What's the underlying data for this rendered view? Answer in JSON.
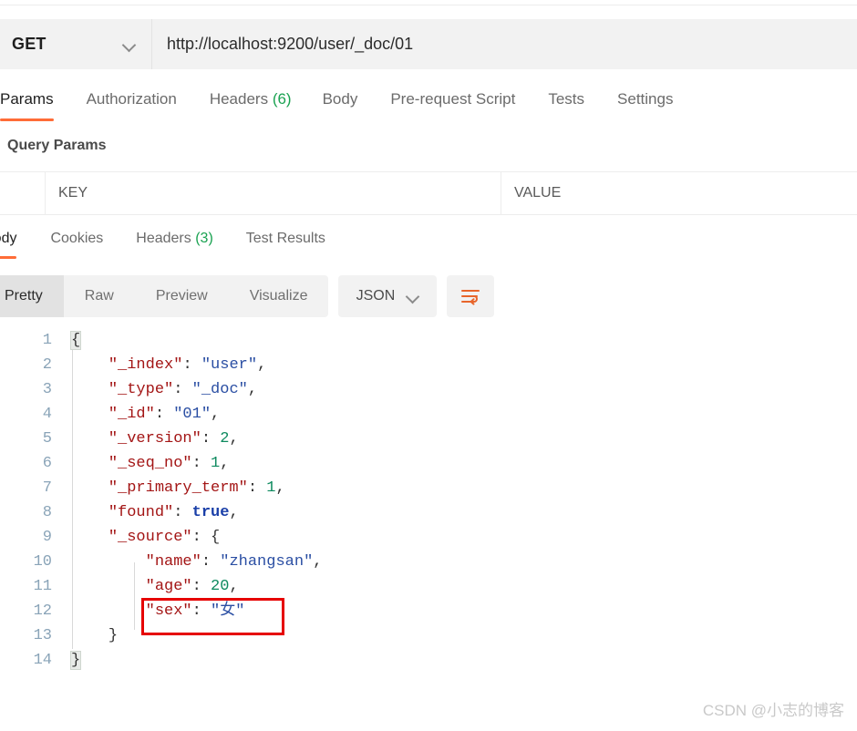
{
  "request": {
    "method": "GET",
    "method_dropdown_icon": "chevron-down-icon",
    "url": "http://localhost:9200/user/_doc/01",
    "url_placeholder": "Enter request URL",
    "tabs": [
      {
        "label": "Params",
        "count": "",
        "active": true
      },
      {
        "label": "Authorization",
        "count": "",
        "active": false
      },
      {
        "label": "Headers",
        "count": "(6)",
        "active": false
      },
      {
        "label": "Body",
        "count": "",
        "active": false
      },
      {
        "label": "Pre-request Script",
        "count": "",
        "active": false
      },
      {
        "label": "Tests",
        "count": "",
        "active": false
      },
      {
        "label": "Settings",
        "count": "",
        "active": false
      }
    ]
  },
  "query_params": {
    "title": "Query Params",
    "columns": [
      "KEY",
      "VALUE"
    ]
  },
  "response": {
    "tabs": [
      {
        "label": "Body",
        "count": "",
        "active": true
      },
      {
        "label": "Cookies",
        "count": "",
        "active": false
      },
      {
        "label": "Headers",
        "count": "(3)",
        "active": false
      },
      {
        "label": "Test Results",
        "count": "",
        "active": false
      }
    ],
    "view_modes": [
      "Pretty",
      "Raw",
      "Preview",
      "Visualize"
    ],
    "active_view_mode": "Pretty",
    "format": "JSON",
    "format_dropdown_icon": "chevron-down-icon",
    "wrap_button_icon": "text-wrap-icon"
  },
  "code": {
    "lines": [
      {
        "no": "1",
        "segments": [
          {
            "t": "{",
            "c": "p br-hl"
          }
        ]
      },
      {
        "no": "2",
        "segments": [
          {
            "t": "    ",
            "c": "p"
          },
          {
            "t": "\"_index\"",
            "c": "k"
          },
          {
            "t": ": ",
            "c": "p"
          },
          {
            "t": "\"user\"",
            "c": "s"
          },
          {
            "t": ",",
            "c": "p"
          }
        ]
      },
      {
        "no": "3",
        "segments": [
          {
            "t": "    ",
            "c": "p"
          },
          {
            "t": "\"_type\"",
            "c": "k"
          },
          {
            "t": ": ",
            "c": "p"
          },
          {
            "t": "\"_doc\"",
            "c": "s"
          },
          {
            "t": ",",
            "c": "p"
          }
        ]
      },
      {
        "no": "4",
        "segments": [
          {
            "t": "    ",
            "c": "p"
          },
          {
            "t": "\"_id\"",
            "c": "k"
          },
          {
            "t": ": ",
            "c": "p"
          },
          {
            "t": "\"01\"",
            "c": "s"
          },
          {
            "t": ",",
            "c": "p"
          }
        ]
      },
      {
        "no": "5",
        "segments": [
          {
            "t": "    ",
            "c": "p"
          },
          {
            "t": "\"_version\"",
            "c": "k"
          },
          {
            "t": ": ",
            "c": "p"
          },
          {
            "t": "2",
            "c": "n"
          },
          {
            "t": ",",
            "c": "p"
          }
        ]
      },
      {
        "no": "6",
        "segments": [
          {
            "t": "    ",
            "c": "p"
          },
          {
            "t": "\"_seq_no\"",
            "c": "k"
          },
          {
            "t": ": ",
            "c": "p"
          },
          {
            "t": "1",
            "c": "n"
          },
          {
            "t": ",",
            "c": "p"
          }
        ]
      },
      {
        "no": "7",
        "segments": [
          {
            "t": "    ",
            "c": "p"
          },
          {
            "t": "\"_primary_term\"",
            "c": "k"
          },
          {
            "t": ": ",
            "c": "p"
          },
          {
            "t": "1",
            "c": "n"
          },
          {
            "t": ",",
            "c": "p"
          }
        ]
      },
      {
        "no": "8",
        "segments": [
          {
            "t": "    ",
            "c": "p"
          },
          {
            "t": "\"found\"",
            "c": "k"
          },
          {
            "t": ": ",
            "c": "p"
          },
          {
            "t": "true",
            "c": "b"
          },
          {
            "t": ",",
            "c": "p"
          }
        ]
      },
      {
        "no": "9",
        "segments": [
          {
            "t": "    ",
            "c": "p"
          },
          {
            "t": "\"_source\"",
            "c": "k"
          },
          {
            "t": ": ",
            "c": "p"
          },
          {
            "t": "{",
            "c": "p"
          }
        ]
      },
      {
        "no": "10",
        "segments": [
          {
            "t": "        ",
            "c": "p"
          },
          {
            "t": "\"name\"",
            "c": "k"
          },
          {
            "t": ": ",
            "c": "p"
          },
          {
            "t": "\"zhangsan\"",
            "c": "s"
          },
          {
            "t": ",",
            "c": "p"
          }
        ]
      },
      {
        "no": "11",
        "segments": [
          {
            "t": "        ",
            "c": "p"
          },
          {
            "t": "\"age\"",
            "c": "k"
          },
          {
            "t": ": ",
            "c": "p"
          },
          {
            "t": "20",
            "c": "n"
          },
          {
            "t": ",",
            "c": "p"
          }
        ]
      },
      {
        "no": "12",
        "segments": [
          {
            "t": "        ",
            "c": "p"
          },
          {
            "t": "\"sex\"",
            "c": "k"
          },
          {
            "t": ": ",
            "c": "p"
          },
          {
            "t": "\"女\"",
            "c": "s"
          }
        ]
      },
      {
        "no": "13",
        "segments": [
          {
            "t": "    ",
            "c": "p"
          },
          {
            "t": "}",
            "c": "p"
          }
        ]
      },
      {
        "no": "14",
        "segments": [
          {
            "t": "}",
            "c": "p br-hl"
          }
        ]
      }
    ],
    "highlight_note": "red-box-on-line-12"
  },
  "watermark": {
    "text": "CSDN @小志的博客"
  },
  "colors": {
    "accent": "#ff6c37",
    "count_green": "#1aa251",
    "annotation_red": "#e60000",
    "json_key": "#a31515",
    "json_string": "#2a4ea3",
    "json_number": "#0e8a5f",
    "json_boolean": "#1a3fa8"
  }
}
